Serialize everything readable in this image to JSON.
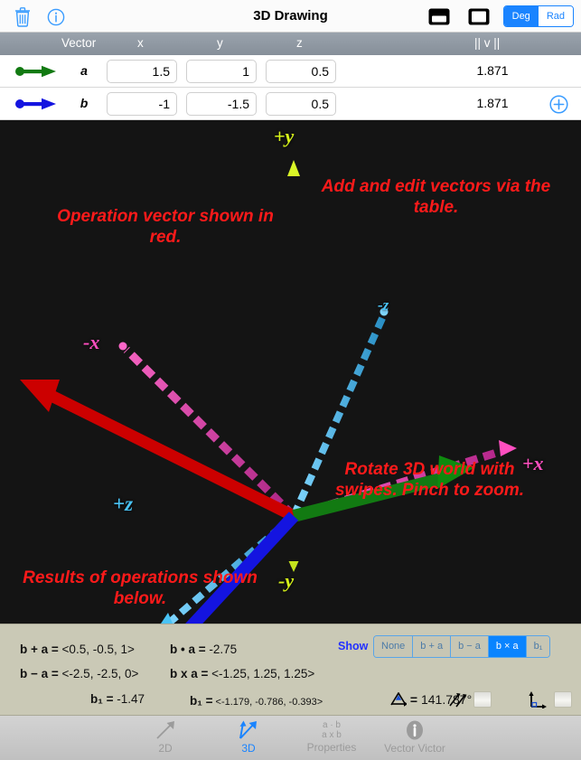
{
  "navbar": {
    "title": "3D Drawing",
    "trash_icon": "trash-icon",
    "info_icon": "info-circle-icon",
    "panel_icon_1": "layout-bottom-panel-icon",
    "panel_icon_2": "layout-full-panel-icon",
    "angle_units": {
      "options": [
        "Deg",
        "Rad"
      ],
      "selected": "Deg"
    }
  },
  "table": {
    "headers": {
      "vector": "Vector",
      "x": "x",
      "y": "y",
      "z": "z",
      "norm": "|| v ||"
    },
    "rows": [
      {
        "name": "a",
        "color": "#167d16",
        "x": "1.5",
        "y": "1",
        "z": "0.5",
        "norm": "1.871"
      },
      {
        "name": "b",
        "color": "#1414e0",
        "x": "-1",
        "y": "-1.5",
        "z": "0.5",
        "norm": "1.871"
      }
    ],
    "add_button": "+"
  },
  "canvas": {
    "axis_labels": {
      "plus_y": "+y",
      "minus_y": "-y",
      "plus_x": "+x",
      "minus_x": "-x",
      "plus_z": "+z",
      "minus_z": "-z"
    },
    "tips": {
      "add_edit": "Add and edit vectors via the table.",
      "operation": "Operation vector shown in red.",
      "rotate": "Rotate 3D world with swipes. Pinch to zoom.",
      "results": "Results of operations shown below."
    },
    "colors": {
      "background": "#141414",
      "y_axis": "#d6f21a",
      "x_axis": "#ff4fc0",
      "z_axis": "#49c3f5",
      "vector_a": "#127a12",
      "vector_b": "#1414e0",
      "operation_vector": "#cc0000",
      "tip_text": "#ff1a1a"
    }
  },
  "results": {
    "sum_label": "b + a =",
    "sum_value": "<0.5, -0.5, 1>",
    "diff_label": "b − a =",
    "diff_value": "<-2.5, -2.5, 0>",
    "dot_label": "b • a =",
    "dot_value": "-2.75",
    "cross_label": "b x a =",
    "cross_value": "<-1.25, 1.25, 1.25>",
    "b1_scalar_label": "b₁ =",
    "b1_scalar_value": "-1.47",
    "b1_vector_label": "b₁ =",
    "b1_vector_value": "<-1.179, -0.786, -0.393>",
    "angle_label": "angle-icon",
    "angle_eq": "=",
    "angle_value": "141.787°",
    "show_label": "Show",
    "show_options": [
      "None",
      "b + a",
      "b − a",
      "b × a",
      "b₁"
    ],
    "show_selected": "b × a",
    "parallel_icon": "parallel-vectors-icon",
    "parallel_checked": false,
    "perpendicular_icon": "perpendicular-vectors-icon",
    "perpendicular_checked": false
  },
  "tabbar": {
    "tabs": [
      {
        "label": "2D",
        "icon": "single-arrow-icon",
        "active": false
      },
      {
        "label": "3D",
        "icon": "double-arrow-icon",
        "active": true
      },
      {
        "label": "Properties",
        "icon_line1": "a · b",
        "icon_line2": "a x b",
        "active": false
      },
      {
        "label": "Vector Victor",
        "icon": "info-circle-filled-icon",
        "active": false
      }
    ]
  }
}
